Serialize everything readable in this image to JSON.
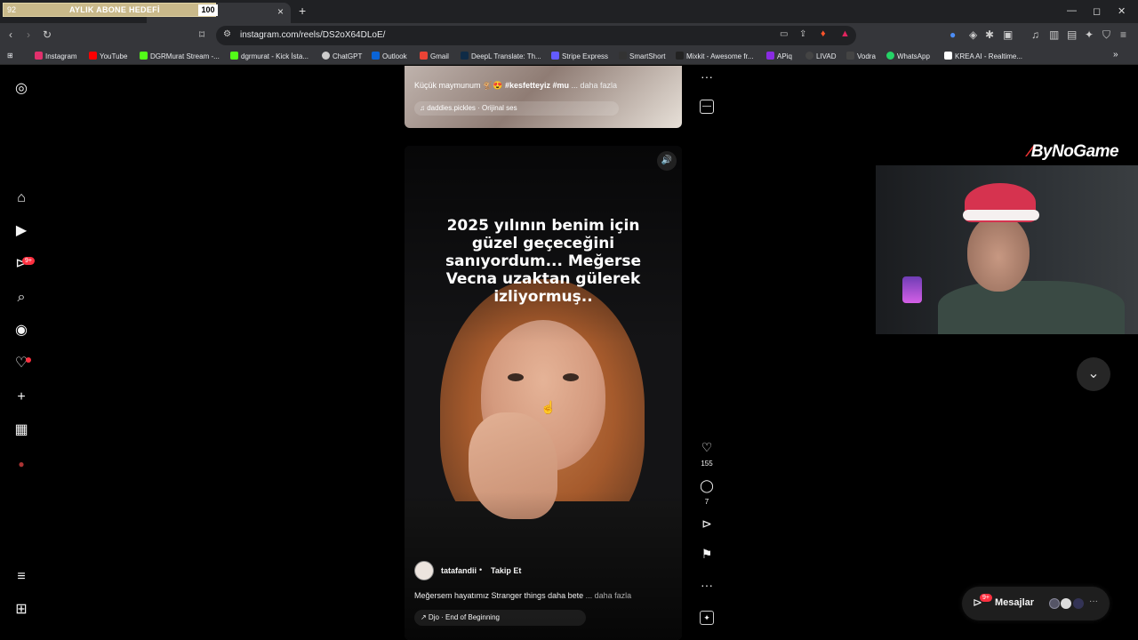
{
  "overlay_goal": {
    "left": "92",
    "label": "AYLIK ABONE HEDEFİ",
    "right": "100"
  },
  "browser": {
    "url": "instagram.com/reels/DS2oX64DLoE/",
    "new_tab": "+",
    "close_tab": "×",
    "window_controls": [
      "—",
      "◻",
      "✕"
    ],
    "bookmarks_more": "»",
    "bookmarks": [
      {
        "label": "Instagram",
        "color": "#e1306c"
      },
      {
        "label": "YouTube",
        "color": "#ff0000"
      },
      {
        "label": "DGRMurat Stream -...",
        "color": "#53fc18"
      },
      {
        "label": "dgrmurat - Kick İsta...",
        "color": "#53fc18"
      },
      {
        "label": "ChatGPT",
        "color": "#cccccc"
      },
      {
        "label": "Outlook",
        "color": "#0a64d6"
      },
      {
        "label": "Gmail",
        "color": "#ea4335"
      },
      {
        "label": "DeepL Translate: Th...",
        "color": "#0f2b46"
      },
      {
        "label": "Stripe Express",
        "color": "#635bff"
      },
      {
        "label": "SmartShort",
        "color": "#333333"
      },
      {
        "label": "Mixkit - Awesome fr...",
        "color": "#222222"
      },
      {
        "label": "APiq",
        "color": "#8a2be2"
      },
      {
        "label": "LIVAD",
        "color": "#444444"
      },
      {
        "label": "Vodra",
        "color": "#444444"
      },
      {
        "label": "WhatsApp",
        "color": "#25d366"
      },
      {
        "label": "KREA AI - Realtime...",
        "color": "#ffffff"
      }
    ]
  },
  "sidebar": {
    "notifications_badge": "9+"
  },
  "prev_reel": {
    "caption_user": "Küçük maymunum",
    "caption_tags": "🐒😍 #kesfetteyiz #mu",
    "caption_more": "... daha fazla",
    "audio": "♫ daddies.pickles · Orijinal ses"
  },
  "reel": {
    "overlay_text": "2025 yılının benim için güzel geçeceğini sanıyordum... Meğerse Vecna uzaktan gülerek izliyormuş..",
    "mute_icon": "🔊",
    "username": "tatafandii",
    "separator": "•",
    "follow": "Takip Et",
    "caption": "Meğersem hayatımız Stranger things daha bete",
    "caption_more": "... daha fazla",
    "audio": "↗ Djo · End of Beginning"
  },
  "actions": {
    "likes": "155",
    "comments": "7",
    "more_top": "···",
    "more": "···"
  },
  "webcam": {
    "brand_prefix": "⁄",
    "brand": "ByNoGame"
  },
  "messages": {
    "label": "Mesajlar",
    "badge": "9+",
    "more": "···"
  }
}
